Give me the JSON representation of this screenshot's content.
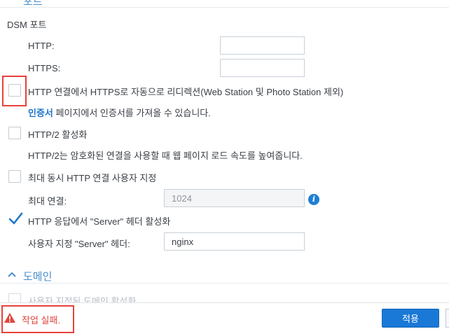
{
  "top_section_title": "포트",
  "dsm_port": {
    "section_label": "DSM 포트",
    "http_label": "HTTP:",
    "http_value": "",
    "https_label": "HTTPS:",
    "https_value": ""
  },
  "redirect": {
    "label": "HTTP 연결에서 HTTPS로 자동으로 리디렉션(Web Station 및 Photo Station 제외)",
    "checked": false
  },
  "certificate_note": {
    "link": "인증서",
    "text": " 페이지에서 인증서를 가져올 수 있습니다."
  },
  "http2": {
    "label": "HTTP/2 활성화",
    "description": "HTTP/2는 암호화된 연결을 사용할 때 웹 페이지 로드 속도를 높여줍니다.",
    "checked": false
  },
  "max_connections": {
    "checkbox_label": "최대 동시 HTTP 연결 사용자 지정",
    "field_label": "최대 연결:",
    "value": "1024",
    "checked": false
  },
  "server_header": {
    "checkbox_label": "HTTP 응답에서 \"Server\" 헤더 활성화",
    "field_label": "사용자 지정 \"Server\" 헤더:",
    "value": "nginx",
    "checked": true
  },
  "domain_section": {
    "title": "도메인",
    "partial_item": "사용자 지정된 도메인 활성화"
  },
  "footer": {
    "error_text": "작업 실패.",
    "apply_label": "적용"
  },
  "colors": {
    "accent": "#1a78d6",
    "section_title": "#4d8fcc",
    "error": "#e0443c",
    "highlight": "#e8413b"
  }
}
